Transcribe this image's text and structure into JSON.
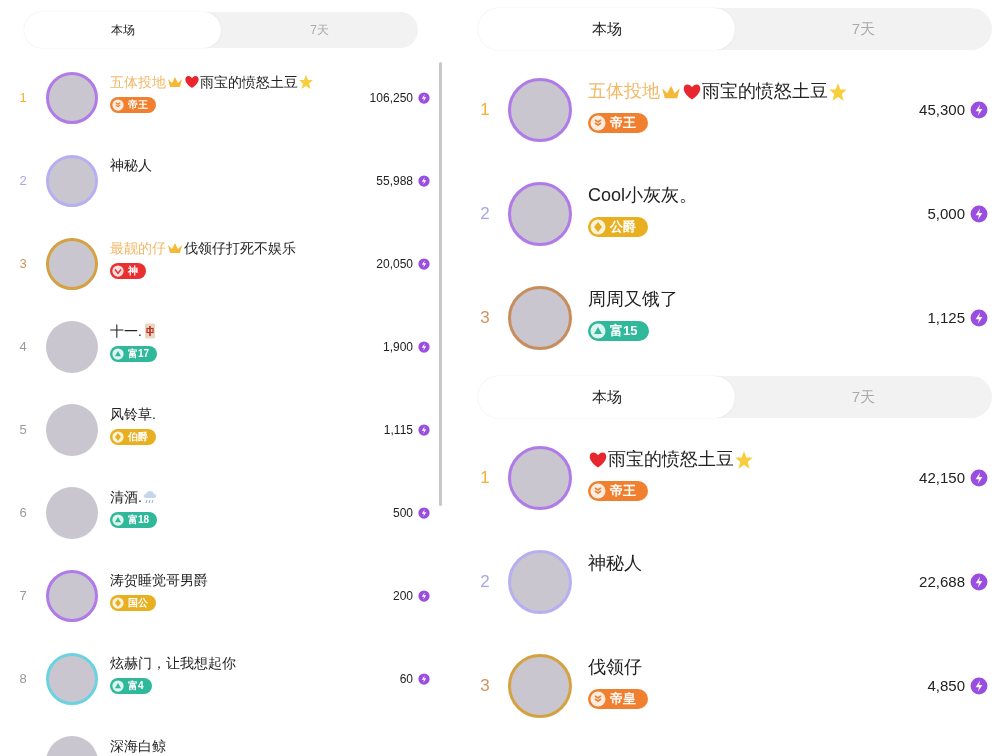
{
  "panels": [
    {
      "kind": "compact",
      "tabs": [
        {
          "label": "本场",
          "selected": true
        },
        {
          "label": "7天",
          "selected": false
        }
      ],
      "rows": [
        {
          "rank": "1",
          "prefix": "五体投地",
          "heart": true,
          "name": "雨宝的愤怒土豆",
          "star": true,
          "tile": false,
          "cloud": false,
          "frame": {
            "color": "#b07ae8"
          },
          "badge": {
            "kind": "royal",
            "label": "帝王"
          },
          "score": "106,250"
        },
        {
          "rank": "2",
          "heart": false,
          "name": "神秘人",
          "star": false,
          "tile": false,
          "cloud": false,
          "frame": {
            "color": "#b7b0f0"
          },
          "score": "55,988"
        },
        {
          "rank": "3",
          "prefix": "最靓的仔",
          "heart": false,
          "name": "伐领仔打死不娱乐",
          "star": false,
          "tile": false,
          "cloud": false,
          "frame": {
            "color": "#d4a240"
          },
          "badge": {
            "kind": "deity",
            "label": "神"
          },
          "score": "20,050"
        },
        {
          "rank": "4",
          "heart": false,
          "name": "十一.",
          "star": false,
          "tile": true,
          "cloud": false,
          "badge": {
            "kind": "rich",
            "label": "富17"
          },
          "score": "1,900"
        },
        {
          "rank": "5",
          "heart": false,
          "name": "风铃草.",
          "star": false,
          "tile": false,
          "cloud": false,
          "badge": {
            "kind": "rank",
            "label": "伯爵"
          },
          "score": "1,115"
        },
        {
          "rank": "6",
          "heart": false,
          "name": "清酒.",
          "star": false,
          "tile": false,
          "cloud": true,
          "badge": {
            "kind": "rich",
            "label": "富18"
          },
          "score": "500"
        },
        {
          "rank": "7",
          "heart": false,
          "name": "涛贺睡觉哥男爵",
          "star": false,
          "tile": false,
          "cloud": false,
          "frame": {
            "color": "#b07ae8"
          },
          "badge": {
            "kind": "rank",
            "label": "国公"
          },
          "score": "200"
        },
        {
          "rank": "8",
          "heart": false,
          "name": "炫赫门，让我想起你",
          "star": false,
          "tile": false,
          "cloud": false,
          "frame": {
            "color": "#6cd2e0"
          },
          "badge": {
            "kind": "rich",
            "label": "富4"
          },
          "score": "60"
        },
        {
          "heart": false,
          "name": "深海白鲸",
          "star": false,
          "tile": false,
          "cloud": false
        }
      ]
    },
    {
      "kind": "large",
      "tabs": [
        {
          "label": "本场",
          "selected": true
        },
        {
          "label": "7天",
          "selected": false
        }
      ],
      "rows": [
        {
          "rank": "1",
          "prefix": "五体投地",
          "heart": true,
          "name": "雨宝的愤怒土豆",
          "star": true,
          "tile": false,
          "cloud": false,
          "frame": {
            "color": "#b07ae8"
          },
          "badge": {
            "kind": "royal",
            "label": "帝王"
          },
          "score": "45,300"
        },
        {
          "rank": "2",
          "heart": false,
          "name": "Cool小灰灰。",
          "star": false,
          "tile": false,
          "cloud": false,
          "frame": {
            "color": "#b07ae8"
          },
          "badge": {
            "kind": "rank",
            "label": "公爵"
          },
          "score": "5,000"
        },
        {
          "rank": "3",
          "heart": false,
          "name": "周周又饿了",
          "star": false,
          "tile": false,
          "cloud": false,
          "frame": {
            "color": "#c88d5c"
          },
          "badge": {
            "kind": "rich",
            "label": "富15"
          },
          "score": "1,125"
        }
      ]
    },
    {
      "kind": "large",
      "tabs": [
        {
          "label": "本场",
          "selected": true
        },
        {
          "label": "7天",
          "selected": false
        }
      ],
      "rows": [
        {
          "rank": "1",
          "heart": true,
          "name": "雨宝的愤怒土豆",
          "star": true,
          "tile": false,
          "cloud": false,
          "frame": {
            "color": "#b07ae8"
          },
          "badge": {
            "kind": "royal",
            "label": "帝王"
          },
          "score": "42,150"
        },
        {
          "rank": "2",
          "heart": false,
          "name": "神秘人",
          "star": false,
          "tile": false,
          "cloud": false,
          "frame": {
            "color": "#b7b0f0"
          },
          "score": "22,688"
        },
        {
          "rank": "3",
          "heart": false,
          "name": "伐领仔",
          "star": false,
          "tile": false,
          "cloud": false,
          "frame": {
            "color": "#d4a240"
          },
          "badge": {
            "kind": "royal",
            "label": "帝皇"
          },
          "score": "4,850"
        }
      ]
    }
  ]
}
